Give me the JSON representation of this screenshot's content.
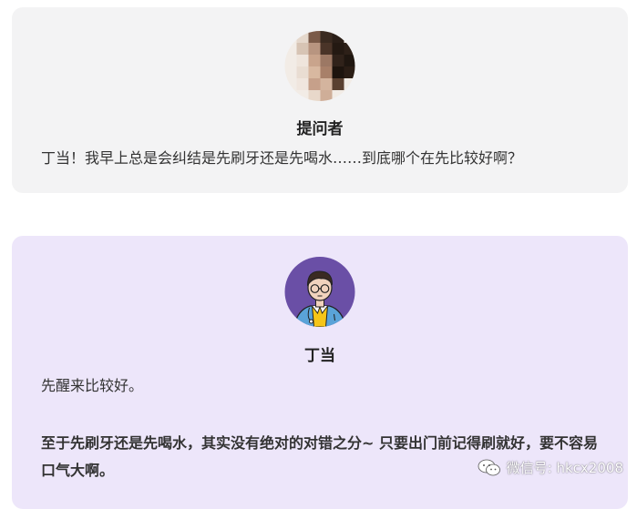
{
  "question": {
    "author": "提问者",
    "avatar_icon": "pixelated-avatar-icon",
    "text": "丁当！我早上总是会纠结是先刷牙还是先喝水……到底哪个在先比较好啊？"
  },
  "answer": {
    "author": "丁当",
    "avatar_icon": "doctor-avatar-icon",
    "line1": "先醒来比较好。",
    "bold_text": "至于先刷牙还是先喝水，其实没有绝对的对错之分~ 只要出门前记得刷就好，要不容易口气大啊。"
  },
  "watermark": {
    "icon": "wechat-icon",
    "text": "微信号: hkcx2008"
  },
  "colors": {
    "question_bg": "#f3f3f4",
    "answer_bg": "#ede6fa",
    "avatar_purple": "#6a4fa6"
  }
}
